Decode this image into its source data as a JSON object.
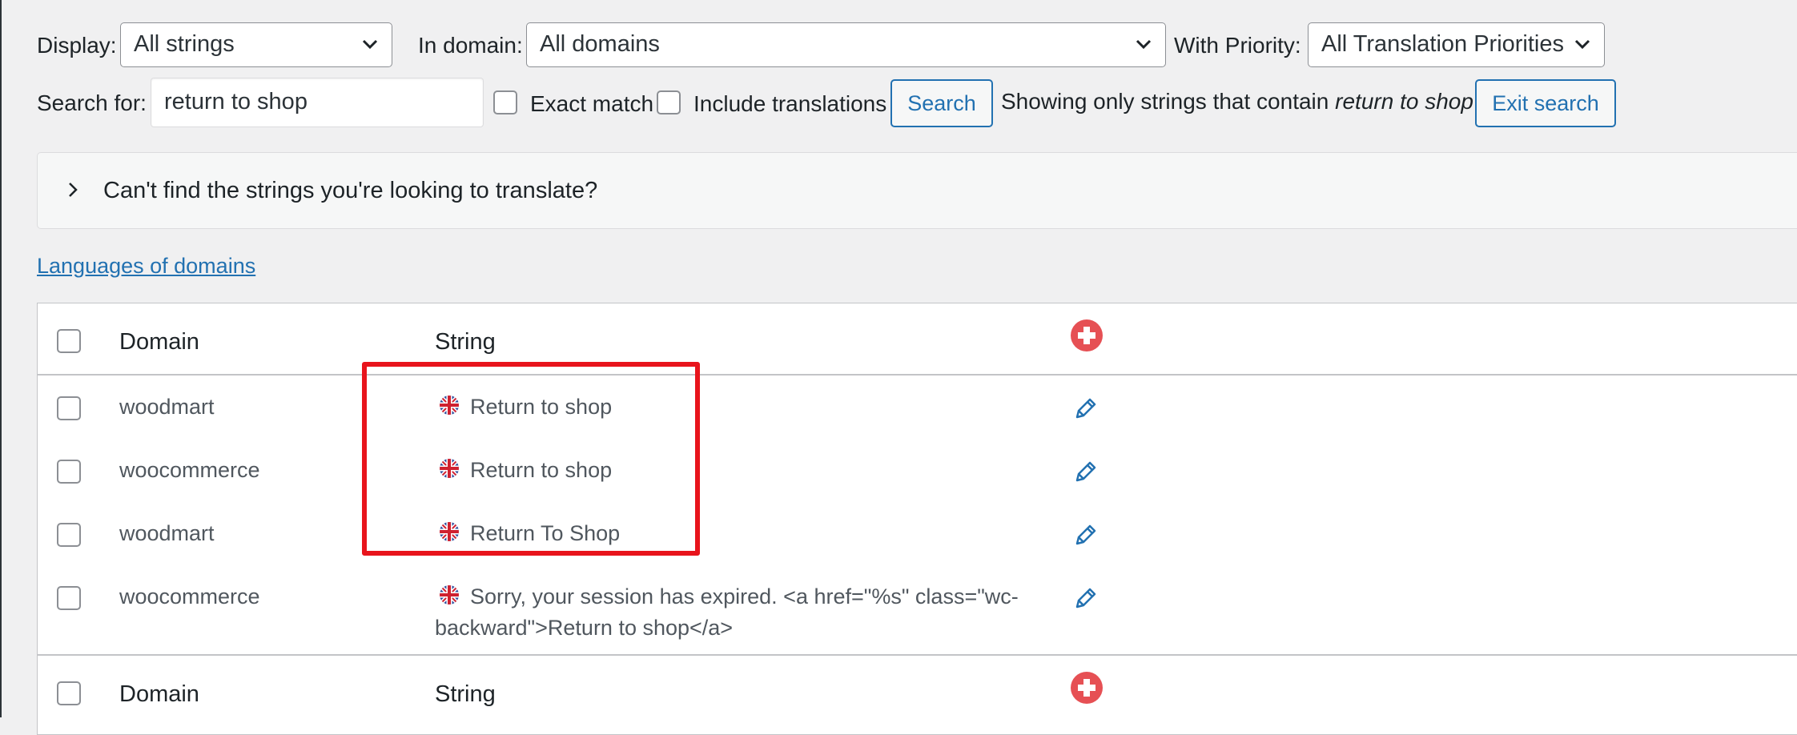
{
  "filters": {
    "display_label": "Display:",
    "display_value": "All strings",
    "domain_label": "In domain:",
    "domain_value": "All domains",
    "priority_label": "With Priority:",
    "priority_value": "All Translation Priorities"
  },
  "search": {
    "label": "Search for:",
    "value": "return to shop",
    "exact_match_label": "Exact match",
    "include_translations_label": "Include translations",
    "search_button": "Search",
    "showing_prefix": "Showing only strings that contain",
    "showing_term": "return to shop",
    "exit_button": "Exit search"
  },
  "notice": {
    "text": "Can't find the strings you're looking to translate?"
  },
  "languages_link": "Languages of domains",
  "table": {
    "header": {
      "domain": "Domain",
      "string": "String"
    },
    "rows": [
      {
        "domain": "woodmart",
        "string": "Return to shop"
      },
      {
        "domain": "woocommerce",
        "string": "Return to shop"
      },
      {
        "domain": "woodmart",
        "string": "Return To Shop"
      },
      {
        "domain": "woocommerce",
        "string_line1": "Sorry, your session has expired. <a href=\"%s\" class=\"wc-",
        "string_line2": "backward\">Return to shop</a>"
      }
    ],
    "footer": {
      "domain": "Domain",
      "string": "String"
    }
  },
  "icons": {
    "chevron": "chevron-down-icon",
    "expand": "chevron-right-icon",
    "flag": "uk-flag-icon",
    "edit": "pencil-icon",
    "add": "plus-circle-icon"
  },
  "colors": {
    "accent": "#2271b1",
    "add_icon": "#e65054",
    "highlight": "#e8141c",
    "background": "#f0f0f1"
  }
}
